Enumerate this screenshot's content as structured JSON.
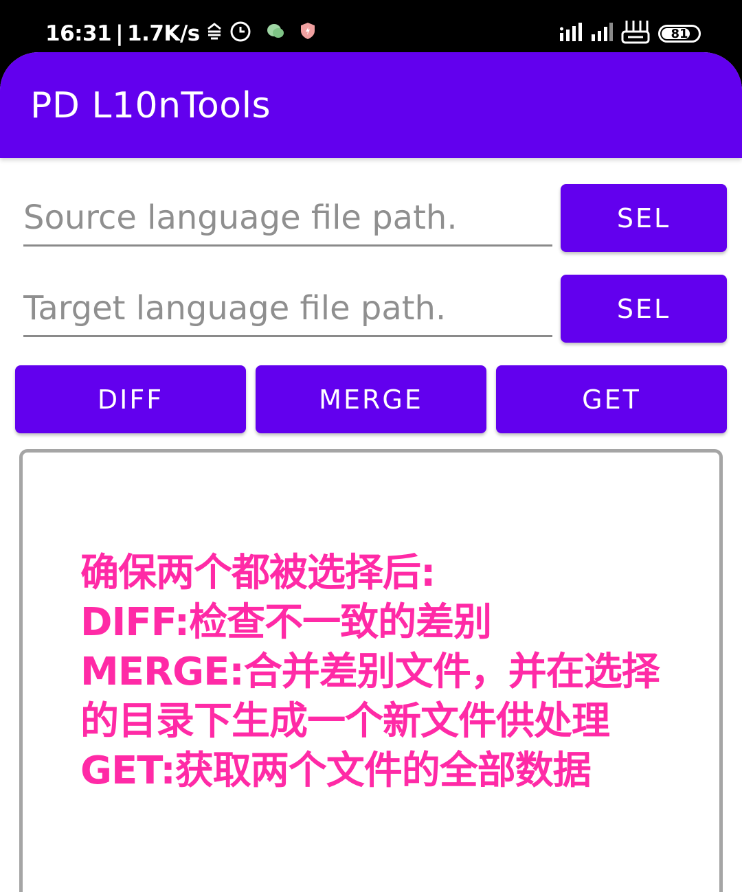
{
  "status_bar": {
    "time": "16:31",
    "separator": "|",
    "net_speed": "1.7K/s",
    "battery_level": "81",
    "battery_fraction": 0.81,
    "icons": [
      "network-activity-icon",
      "alarm-clock-icon",
      "wechat-icon",
      "shield-icon",
      "signal-bars-icon",
      "signal-bars-icon-2",
      "router-icon",
      "battery-icon"
    ]
  },
  "app_bar": {
    "title": "PD L10nTools",
    "color": "#6200ee"
  },
  "source_field": {
    "placeholder": "Source language file path.",
    "value": ""
  },
  "target_field": {
    "placeholder": "Target language file path.",
    "value": ""
  },
  "source_sel_button": {
    "label": "SEL"
  },
  "target_sel_button": {
    "label": "SEL"
  },
  "actions": {
    "diff_label": "DIFF",
    "merge_label": "MERGE",
    "get_label": "GET"
  },
  "output": {
    "text": "确保两个都被选择后:\nDIFF:检查不一致的差别\nMERGE:合并差别文件，并在选择\n的目录下生成一个新文件供处理\nGET:获取两个文件的全部数据",
    "text_color": "#ff2aa6"
  }
}
